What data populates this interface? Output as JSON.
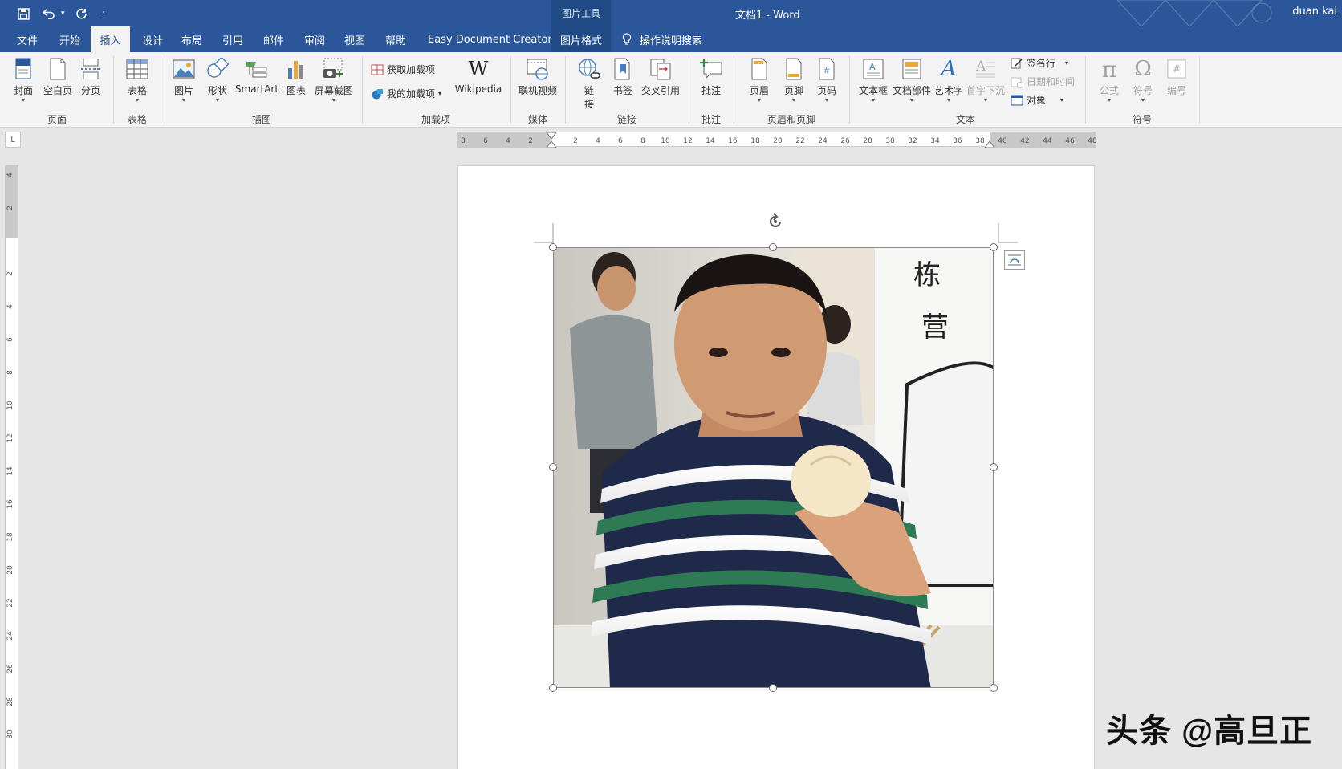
{
  "titlebar": {
    "doc_title": "文档1  -  Word",
    "context_group": "图片工具",
    "user": "duan kai"
  },
  "tabs": [
    {
      "label": "文件"
    },
    {
      "label": "开始"
    },
    {
      "label": "插入"
    },
    {
      "label": "设计"
    },
    {
      "label": "布局"
    },
    {
      "label": "引用"
    },
    {
      "label": "邮件"
    },
    {
      "label": "审阅"
    },
    {
      "label": "视图"
    },
    {
      "label": "帮助"
    },
    {
      "label": "Easy Document Creator"
    },
    {
      "label": "图片格式"
    }
  ],
  "active_tab": "插入",
  "search": {
    "label": "操作说明搜索",
    "icon": "lightbulb-icon"
  },
  "ribbon": {
    "groups": {
      "pages": "页面",
      "table": "表格",
      "illustrations": "插图",
      "addins": "加载项",
      "media": "媒体",
      "links": "链接",
      "comments": "批注",
      "header_footer": "页眉和页脚",
      "text": "文本",
      "symbols": "符号"
    },
    "buttons": {
      "cover": "封面",
      "blank_page": "空白页",
      "page_break": "分页",
      "table": "表格",
      "picture": "图片",
      "shapes": "形状",
      "smartart": "SmartArt",
      "chart": "图表",
      "screenshot": "屏幕截图",
      "get_addins": "获取加载项",
      "my_addins": "我的加载项",
      "wikipedia": "Wikipedia",
      "online_video": "联机视频",
      "link_1": "链",
      "link_2": "接",
      "bookmark": "书签",
      "cross_ref": "交叉引用",
      "comment": "批注",
      "header": "页眉",
      "footer": "页脚",
      "page_number": "页码",
      "textbox": "文本框",
      "quick_parts": "文档部件",
      "wordart": "艺术字",
      "drop_cap": "首字下沉",
      "signature": "签名行",
      "date_time": "日期和时间",
      "object": "对象",
      "equation": "公式",
      "symbol": "符号",
      "number": "编号"
    }
  },
  "ruler": {
    "corner": "L",
    "h_ticks": [
      "8",
      "6",
      "4",
      "2",
      "",
      "2",
      "4",
      "6",
      "8",
      "10",
      "12",
      "14",
      "16",
      "18",
      "20",
      "22",
      "24",
      "26",
      "28",
      "30",
      "32",
      "34",
      "36",
      "38",
      "40",
      "42",
      "44",
      "46",
      "48"
    ],
    "v_ticks": [
      "4",
      "2",
      "",
      "2",
      "4",
      "6",
      "8",
      "10",
      "12",
      "14",
      "16",
      "18",
      "20",
      "22",
      "24",
      "26",
      "28",
      "30"
    ]
  },
  "watermark": "头条 @高旦正",
  "colors": {
    "accent": "#2b579a",
    "ribbon_bg": "#f3f3f3",
    "canvas": "#e6e6e6"
  }
}
